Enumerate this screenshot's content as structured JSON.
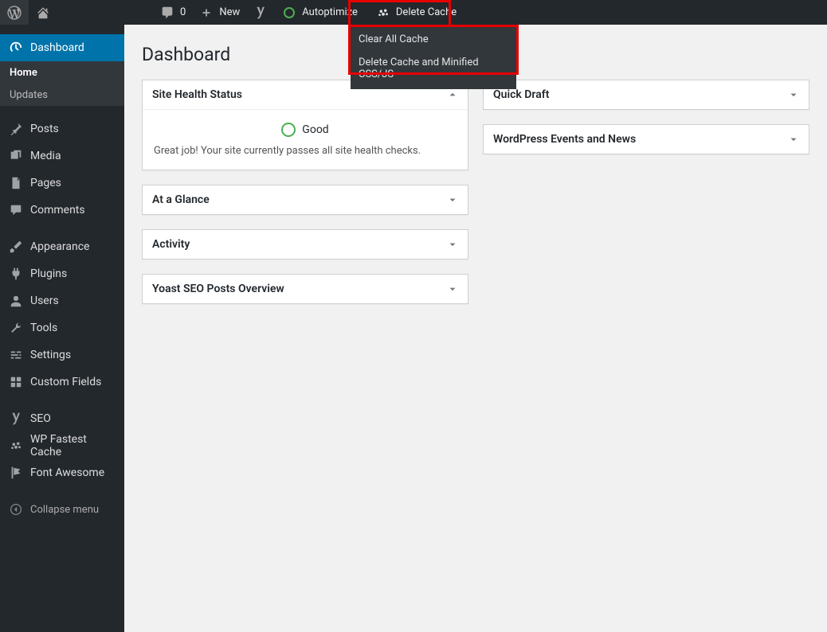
{
  "adminbar": {
    "comments_count": "0",
    "new_label": "New",
    "autoptimize_label": "Autoptimize",
    "delete_cache_label": "Delete Cache",
    "delete_cache_dropdown": [
      "Clear All Cache",
      "Delete Cache and Minified CSS/JS"
    ]
  },
  "sidebar": {
    "dashboard_label": "Dashboard",
    "dashboard_sub": {
      "home": "Home",
      "updates": "Updates"
    },
    "posts": "Posts",
    "media": "Media",
    "pages": "Pages",
    "comments": "Comments",
    "appearance": "Appearance",
    "plugins": "Plugins",
    "users": "Users",
    "tools": "Tools",
    "settings": "Settings",
    "custom_fields": "Custom Fields",
    "seo": "SEO",
    "wpfc": "WP Fastest Cache",
    "font_awesome": "Font Awesome",
    "collapse": "Collapse menu"
  },
  "page": {
    "title": "Dashboard"
  },
  "widgets": {
    "site_health": {
      "title": "Site Health Status",
      "status_label": "Good",
      "message": "Great job! Your site currently passes all site health checks."
    },
    "at_a_glance": {
      "title": "At a Glance"
    },
    "activity": {
      "title": "Activity"
    },
    "yoast_posts": {
      "title": "Yoast SEO Posts Overview"
    },
    "quick_draft": {
      "title": "Quick Draft"
    },
    "wp_news": {
      "title": "WordPress Events and News"
    }
  }
}
